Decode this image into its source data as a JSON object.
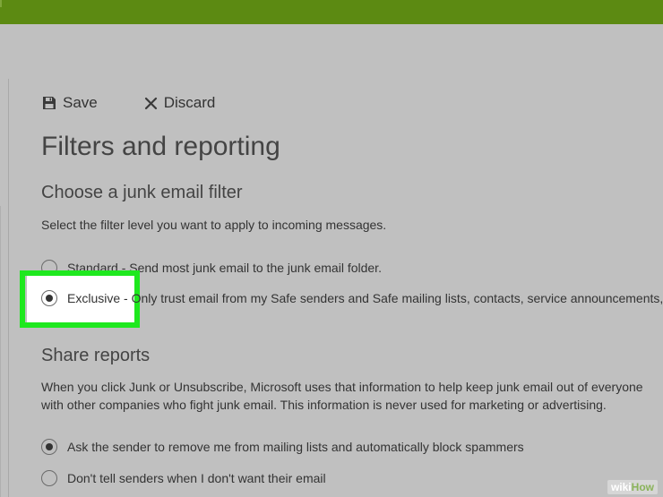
{
  "toolbar": {
    "save_label": "Save",
    "discard_label": "Discard"
  },
  "page": {
    "title": "Filters and reporting"
  },
  "junk_filter": {
    "heading": "Choose a junk email filter",
    "description": "Select the filter level you want to apply to incoming messages.",
    "options": [
      {
        "label": "Standard - Send most junk email to the junk email folder.",
        "selected": false
      },
      {
        "label": "Exclusive - Only trust email from my Safe senders and Safe mailing lists, contacts, service announcements,",
        "selected": true
      }
    ]
  },
  "share_reports": {
    "heading": "Share reports",
    "description_line1": "When you click Junk or Unsubscribe, Microsoft uses that information to help keep junk email out of everyone",
    "description_line2": "with other companies who fight junk email. This information is never used for marketing or advertising.",
    "options": [
      {
        "label": "Ask the sender to remove me from mailing lists and automatically block spammers",
        "selected": true
      },
      {
        "label": "Don't tell senders when I don't want their email",
        "selected": false
      }
    ]
  },
  "watermark": {
    "wiki": "wiki",
    "how": "How"
  },
  "colors": {
    "top_bar": "#5c8a12",
    "background": "#c0c0c0",
    "highlight_border": "#1ee81e"
  }
}
